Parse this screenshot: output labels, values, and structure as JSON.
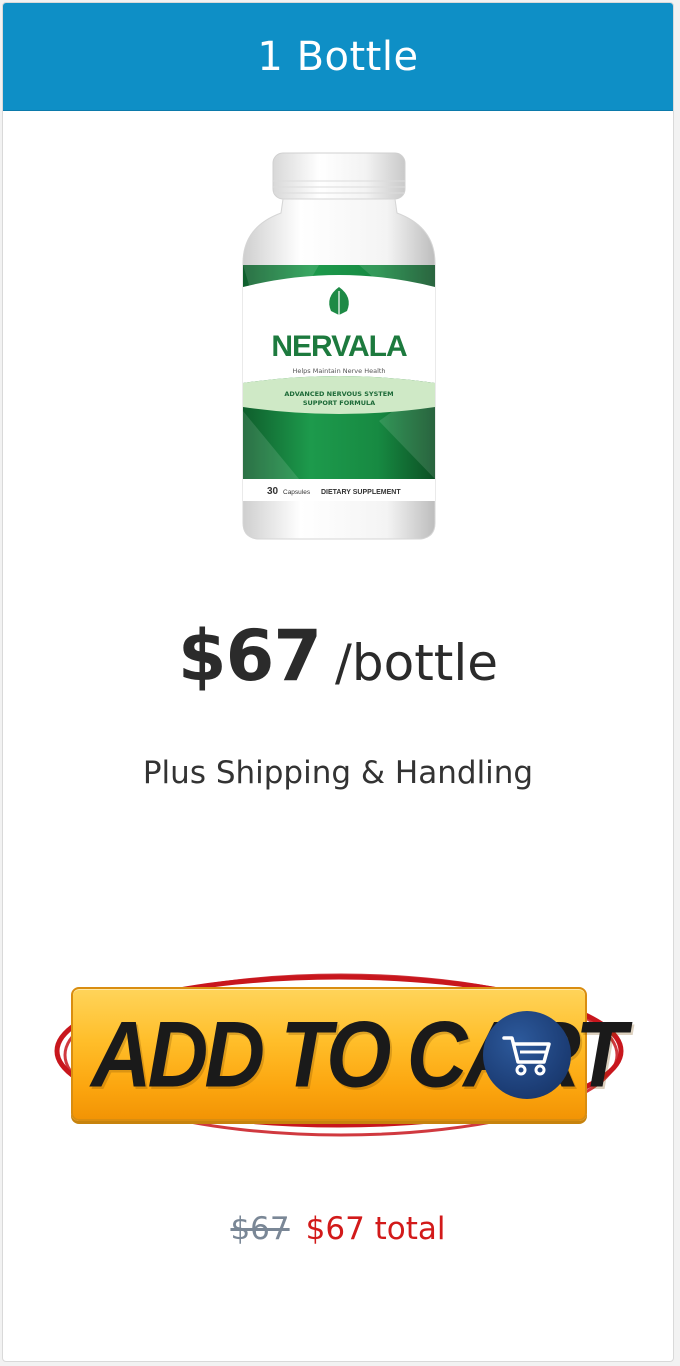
{
  "header": {
    "title": "1 Bottle"
  },
  "product": {
    "brand": "NERVALA",
    "tagline": "Helps Maintain Nerve Health",
    "formula": "ADVANCED NERVOUS SYSTEM SUPPORT FORMULA",
    "count": "30",
    "count_unit": "Capsules",
    "supplement": "DIETARY SUPPLEMENT"
  },
  "pricing": {
    "amount": "$67",
    "unit": "/bottle",
    "shipping_note": "Plus Shipping & Handling",
    "old_price": "$67",
    "total": "$67 total"
  },
  "cta": {
    "label": "ADD TO CART",
    "icon": "shopping-cart-icon"
  },
  "colors": {
    "header": "#0e8fc6",
    "button": "#ffbe2a",
    "ring": "#c8161d",
    "total": "#d21a1a",
    "bottle_green": "#1d8a45"
  }
}
